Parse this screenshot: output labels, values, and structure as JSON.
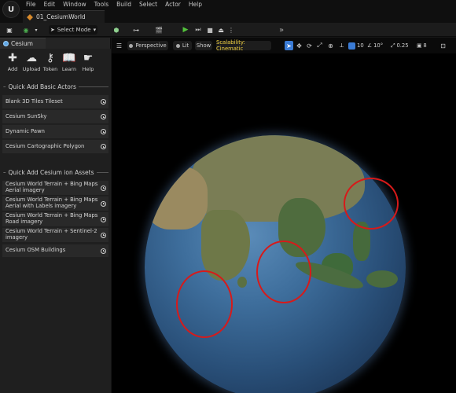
{
  "menu": {
    "logo": "U",
    "items": [
      "File",
      "Edit",
      "Window",
      "Tools",
      "Build",
      "Select",
      "Actor",
      "Help"
    ]
  },
  "tab": {
    "level": "01_CesiumWorld"
  },
  "toolbar": {
    "mode": "Select Mode",
    "overflow": "»"
  },
  "panel": {
    "tab_label": "Cesium",
    "actions": [
      {
        "label": "Add",
        "icon": "plus-icon",
        "glyph": "✚"
      },
      {
        "label": "Upload",
        "icon": "cloud-upload-icon",
        "glyph": "☁"
      },
      {
        "label": "Token",
        "icon": "key-icon",
        "glyph": "⚷"
      },
      {
        "label": "Learn",
        "icon": "book-icon",
        "glyph": "📖"
      },
      {
        "label": "Help",
        "icon": "help-icon",
        "glyph": "☛"
      }
    ],
    "basic_title": "Quick Add Basic Actors",
    "basic_items": [
      "Blank 3D Tiles Tileset",
      "Cesium SunSky",
      "Dynamic Pawn",
      "Cesium Cartographic Polygon"
    ],
    "ion_title": "Quick Add Cesium ion Assets",
    "ion_items": [
      "Cesium World Terrain + Bing Maps Aerial imagery",
      "Cesium World Terrain + Bing Maps Aerial with Labels imagery",
      "Cesium World Terrain + Bing Maps Road imagery",
      "Cesium World Terrain + Sentinel-2 imagery",
      "Cesium OSM Buildings"
    ]
  },
  "viewport": {
    "perspective": "Perspective",
    "lit": "Lit",
    "show": "Show",
    "scalability": "Scalability: Cinematic",
    "grid_snap": "10",
    "rot_snap": "10°",
    "scale_snap": "0.25",
    "cam_speed": "8"
  },
  "colors": {
    "accent": "#3a7bd5",
    "play": "#53c23c",
    "highlight": "#f0d040",
    "circle": "#d71a1a"
  }
}
